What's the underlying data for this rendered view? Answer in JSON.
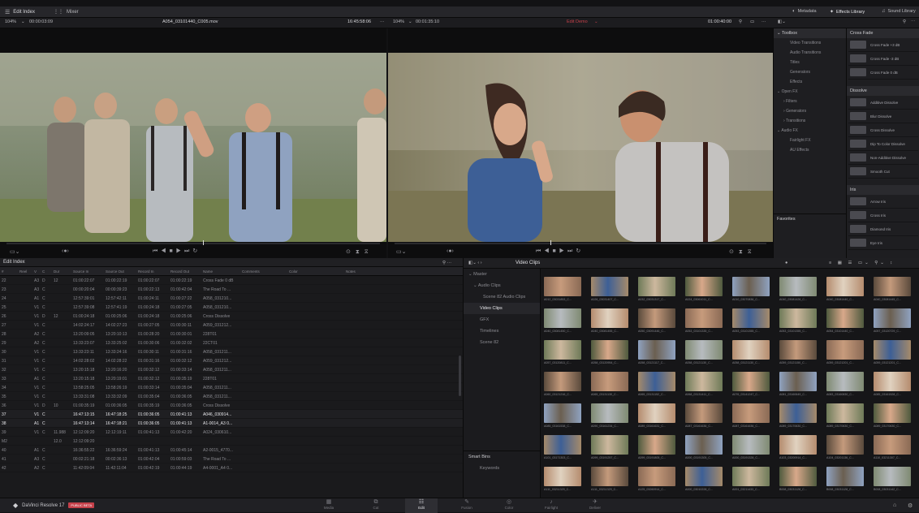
{
  "topbar": {
    "edit_index": "Edit Index",
    "mixer": "Mixer",
    "metadata": "Metadata",
    "effects_library": "Effects Library",
    "sound_library": "Sound Library"
  },
  "source_viewer": {
    "zoom": "104%",
    "timecode": "00:00:03:09",
    "clip_name": "A054_03101440_C005.mov",
    "duration": "16:45:58:06"
  },
  "timeline_viewer": {
    "zoom": "104%",
    "timecode": "00:01:35:10",
    "timeline_name": "Edit Demo",
    "tc_right": "01:00:40:00"
  },
  "toolbox": {
    "header": "Toolbox",
    "items": [
      "Video Transitions",
      "Audio Transitions",
      "Titles",
      "Generators",
      "Effects"
    ],
    "open_fx": "Open FX",
    "open_fx_items": [
      "Filters",
      "Generators",
      "Transitions"
    ],
    "audio_fx": "Audio FX",
    "audio_fx_items": [
      "Fairlight FX",
      "AU Effects"
    ],
    "favorites": "Favorites"
  },
  "transitions": {
    "cross_fade": "Cross Fade",
    "cross_fade_items": [
      "Cross Fade +3 dB",
      "Cross Fade -3 dB",
      "Cross Fade 0 dB"
    ],
    "dissolve": "Dissolve",
    "dissolve_items": [
      "Additive Dissolve",
      "Blur Dissolve",
      "Cross Dissolve",
      "Dip To Color Dissolve",
      "Non-Additive Dissolve",
      "Smooth Cut"
    ],
    "iris": "Iris",
    "iris_items": [
      "Arrow Iris",
      "Cross Iris",
      "Diamond Iris",
      "Eye Iris"
    ]
  },
  "edit_index": {
    "title": "Edit Index",
    "columns": [
      "#",
      "Reel",
      "V",
      "C",
      "Dur",
      "Source In",
      "Source Out",
      "Record In",
      "Record Out",
      "Name",
      "Comments",
      "Color",
      "Notes"
    ],
    "rows": [
      [
        "22",
        "",
        "A3",
        "D",
        "12",
        "01:00:22:07",
        "01:00:22:19",
        "01:00:22:07",
        "01:00:22:19",
        "Cross Fade 0 dB"
      ],
      [
        "23",
        "",
        "A3",
        "C",
        "",
        "00:00:20:04",
        "00:00:39:23",
        "01:00:22:13",
        "01:00:42:04",
        "The Road To ..."
      ],
      [
        "24",
        "",
        "A1",
        "C",
        "",
        "12:57:39:01",
        "12:57:42:11",
        "01:00:24:11",
        "01:00:27:22",
        "A058_031210..."
      ],
      [
        "25",
        "",
        "V1",
        "C",
        "",
        "12:57:39:08",
        "12:57:41:19",
        "01:00:24:18",
        "01:00:27:05",
        "A058_031210..."
      ],
      [
        "26",
        "",
        "V1",
        "D",
        "12",
        "01:00:24:18",
        "01:00:25:06",
        "01:00:24:18",
        "01:00:25:06",
        "Cross Dissolve"
      ],
      [
        "27",
        "",
        "V1",
        "C",
        "",
        "14:02:24:17",
        "14:02:27:23",
        "01:00:27:05",
        "01:00:30:11",
        "A059_031212..."
      ],
      [
        "28",
        "",
        "A2",
        "C",
        "",
        "13:20:09:05",
        "13:20:10:13",
        "01:00:28:20",
        "01:00:30:01",
        "228T01"
      ],
      [
        "29",
        "",
        "A2",
        "C",
        "",
        "13:33:23:07",
        "13:33:25:02",
        "01:00:30:06",
        "01:00:32:02",
        "22CT01"
      ],
      [
        "30",
        "",
        "V1",
        "C",
        "",
        "13:33:23:11",
        "13:33:24:16",
        "01:00:30:11",
        "01:00:31:16",
        "A058_031211..."
      ],
      [
        "31",
        "",
        "V1",
        "C",
        "",
        "14:02:28:02",
        "14:02:28:22",
        "01:00:31:16",
        "01:00:32:12",
        "A059_031212..."
      ],
      [
        "32",
        "",
        "V1",
        "C",
        "",
        "13:20:15:18",
        "13:20:16:20",
        "01:00:32:12",
        "01:00:33:14",
        "A058_031211..."
      ],
      [
        "33",
        "",
        "A1",
        "C",
        "",
        "13:20:15:18",
        "13:20:19:01",
        "01:00:32:12",
        "01:00:35:19",
        "228T01"
      ],
      [
        "34",
        "",
        "V1",
        "C",
        "",
        "13:58:25:05",
        "13:58:26:19",
        "01:00:33:14",
        "01:00:35:04",
        "A058_031211..."
      ],
      [
        "35",
        "",
        "V1",
        "C",
        "",
        "13:33:31:08",
        "13:33:32:09",
        "01:00:35:04",
        "01:00:36:05",
        "A058_031211..."
      ],
      [
        "36",
        "",
        "V1",
        "D",
        "10",
        "01:00:35:19",
        "01:00:36:05",
        "01:00:35:19",
        "01:00:36:05",
        "Cross Dissolve"
      ],
      [
        "37",
        "",
        "V1",
        "C",
        "",
        "16:47:13:15",
        "16:47:18:25",
        "01:00:36:05",
        "01:00:41:13",
        "A046_030914..."
      ],
      [
        "38",
        "",
        "A1",
        "C",
        "",
        "16:47:13:14",
        "16:47:18:21",
        "01:00:36:05",
        "01:00:41:13",
        "A1-0014_A3 0..."
      ],
      [
        "39",
        "",
        "V1",
        "C",
        "11.988",
        "12:12:09:20",
        "12:12:19:11",
        "01:00:41:13",
        "01:00:42:20",
        "A024_030610..."
      ],
      [
        "M2",
        "",
        "",
        "",
        "12.0",
        "12:12:09:20",
        "",
        "",
        "",
        "",
        ""
      ],
      [
        "40",
        "",
        "A1",
        "C",
        "",
        "16:36:55:22",
        "16:36:59:24",
        "01:00:41:13",
        "01:00:45:14",
        "A2-0015_4770..."
      ],
      [
        "41",
        "",
        "A3",
        "C",
        "",
        "00:02:21:18",
        "00:02:36:13",
        "01:00:42:04",
        "01:00:59:03",
        "The Road To ..."
      ],
      [
        "42",
        "",
        "A2",
        "C",
        "",
        "11:42:09:04",
        "11:42:11:04",
        "01:00:42:19",
        "01:00:44:19",
        "A4-0001_A4 0..."
      ]
    ],
    "highlighted": [
      15,
      16
    ]
  },
  "media_pool": {
    "folder": "Video Clips",
    "bins": [
      "Master",
      "Audio Clips",
      "Scene 82 Audio Clips",
      "Video Clips",
      "GFX",
      "Timelines",
      "Scene 82"
    ],
    "smart_bins": "Smart Bins",
    "smart_items": [
      "Keywords"
    ],
    "clips": [
      "A012_03031853_C...",
      "A026_03031407_C...",
      "A032_03031317_C...",
      "A024_03061011_C...",
      "A010_03070836_C...",
      "A040_03081426_C...",
      "A040_03081440_C...",
      "A040_03081445_C...",
      "A040_03081450_C...",
      "A040_03081455_C...",
      "A050_03091446_C...",
      "A053_03101335_C...",
      "A053_03101355_C...",
      "A053_03101355_C...",
      "A054_03101440_C...",
      "A057_03120729_C...",
      "A057_03120811_C...",
      "A058_03120954_C...",
      "A058_03121117_C...",
      "A058_03121130_C...",
      "A058_03121130_C...",
      "A059_03121150_C...",
      "A059_03121201_C...",
      "A059_03121201_C...",
      "A060_03121216_C...",
      "A065_03131130_C...",
      "A065_03131152_C...",
      "A068_03131411_C...",
      "A076_03141247_C...",
      "A081_03160649_C...",
      "A083_03160830_C...",
      "A085_03161528_C...",
      "A085_03161538_C...",
      "A090_03161234_C...",
      "A089_03161631_C...",
      "A087_03161636_C...",
      "A087_03161636_C...",
      "A089_03170630_C...",
      "A089_03170630_C...",
      "A089_03170630_C...",
      "A101_03171303_C...",
      "A099_03191257_C...",
      "A099_03191805_C...",
      "A000_03191305_C...",
      "A000_03191328_C...",
      "A103_03200914_C...",
      "A104_03201136_C...",
      "A110_03211307_C...",
      "A111_03211329_C...",
      "A111_03211329_C...",
      "A125_03260914_C...",
      "A000_03010228_C...",
      "A001_03211433_C...",
      "B008_03031128_C...",
      "B008_03031128_C...",
      "B008_03031142_C..."
    ]
  },
  "app": {
    "name": "DaVinci Resolve 17",
    "badge": "PUBLIC BETA"
  },
  "pages": [
    "Media",
    "Cut",
    "Edit",
    "Fusion",
    "Color",
    "Fairlight",
    "Deliver"
  ],
  "active_page": "Edit",
  "colors": {
    "accent": "#c5404a",
    "highlight": "#e8e8ec"
  }
}
